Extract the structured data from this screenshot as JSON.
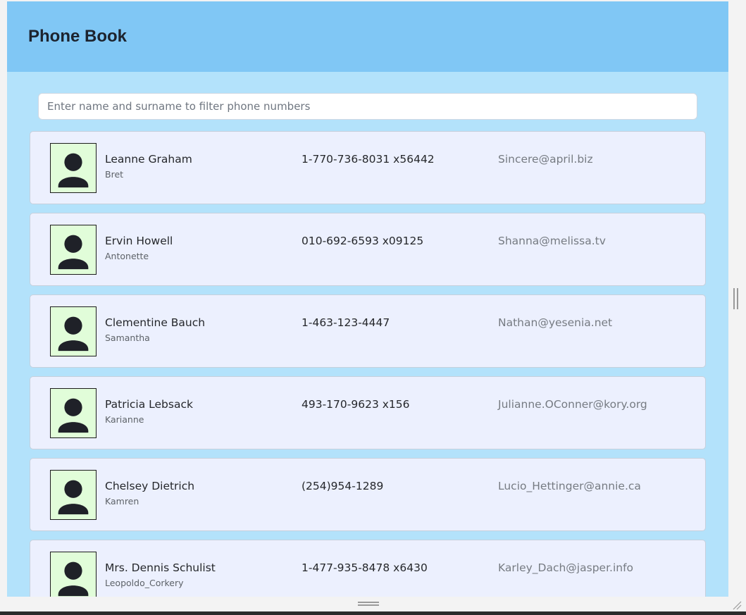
{
  "header": {
    "title": "Phone Book"
  },
  "search": {
    "placeholder": "Enter name and surname to filter phone numbers",
    "value": ""
  },
  "contacts": [
    {
      "name": "Leanne Graham",
      "username": "Bret",
      "phone": "1-770-736-8031 x56442",
      "email": "Sincere@april.biz"
    },
    {
      "name": "Ervin Howell",
      "username": "Antonette",
      "phone": "010-692-6593 x09125",
      "email": "Shanna@melissa.tv"
    },
    {
      "name": "Clementine Bauch",
      "username": "Samantha",
      "phone": "1-463-123-4447",
      "email": "Nathan@yesenia.net"
    },
    {
      "name": "Patricia Lebsack",
      "username": "Karianne",
      "phone": "493-170-9623 x156",
      "email": "Julianne.OConner@kory.org"
    },
    {
      "name": "Chelsey Dietrich",
      "username": "Kamren",
      "phone": "(254)954-1289",
      "email": "Lucio_Hettinger@annie.ca"
    },
    {
      "name": "Mrs. Dennis Schulist",
      "username": "Leopoldo_Corkery",
      "phone": "1-477-935-8478 x6430",
      "email": "Karley_Dach@jasper.info"
    }
  ],
  "colors": {
    "header_bg": "#80c7f5",
    "page_bg": "#b3e2fb",
    "card_bg": "#ecf0fe",
    "avatar_bg": "#e1fdd9"
  },
  "icons": {
    "avatar": "person-icon"
  }
}
